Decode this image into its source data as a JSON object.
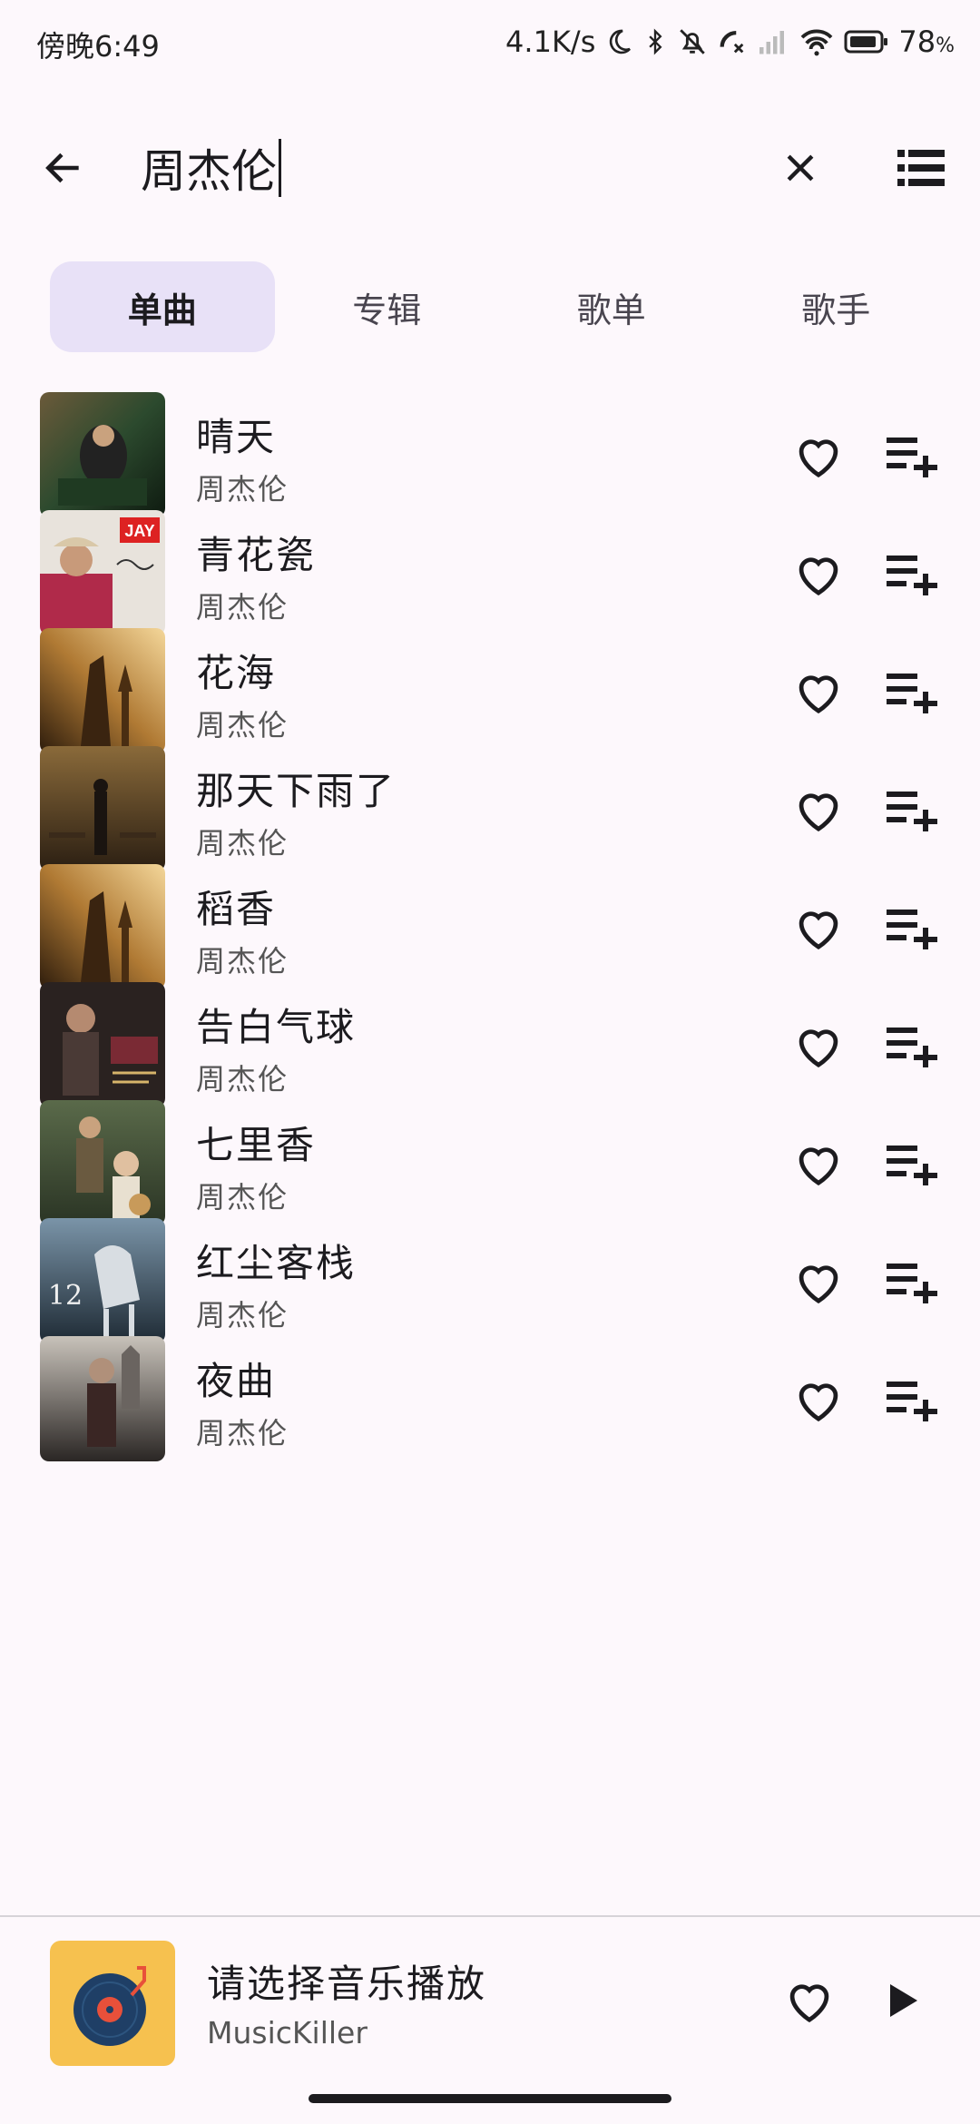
{
  "status_bar": {
    "time": "傍晚6:49",
    "network_speed": "4.1K/s",
    "battery": "78",
    "battery_unit": "%",
    "icons": [
      "moon-icon",
      "bluetooth-icon",
      "mute-bell-icon",
      "missed-call-icon",
      "cellular-signal-icon",
      "wifi-icon",
      "battery-icon"
    ]
  },
  "search": {
    "query": "周杰伦",
    "back_icon": "arrow-left-icon",
    "clear_icon": "close-icon",
    "view_icon": "list-view-icon"
  },
  "tabs": [
    {
      "label": "单曲",
      "active": true
    },
    {
      "label": "专辑",
      "active": false
    },
    {
      "label": "歌单",
      "active": false
    },
    {
      "label": "歌手",
      "active": false
    }
  ],
  "songs": [
    {
      "title": "晴天",
      "artist": "周杰伦"
    },
    {
      "title": "青花瓷",
      "artist": "周杰伦",
      "cover_text": "JAY"
    },
    {
      "title": "花海",
      "artist": "周杰伦"
    },
    {
      "title": "那天下雨了",
      "artist": "周杰伦"
    },
    {
      "title": "稻香",
      "artist": "周杰伦"
    },
    {
      "title": "告白气球",
      "artist": "周杰伦"
    },
    {
      "title": "七里香",
      "artist": "周杰伦"
    },
    {
      "title": "红尘客栈",
      "artist": "周杰伦",
      "cover_text": "12"
    },
    {
      "title": "夜曲",
      "artist": "周杰伦"
    }
  ],
  "row_icons": {
    "favorite": "heart-outline-icon",
    "add": "playlist-add-icon"
  },
  "player": {
    "title": "请选择音乐播放",
    "subtitle": "MusicKiller",
    "favorite_icon": "heart-outline-icon",
    "play_icon": "play-icon"
  },
  "colors": {
    "background": "#fdf8fc",
    "tab_active_bg": "#e8e1f7",
    "text_primary": "#1c1b1f",
    "text_secondary": "#555555",
    "player_cover_bg": "#f6c14f"
  }
}
